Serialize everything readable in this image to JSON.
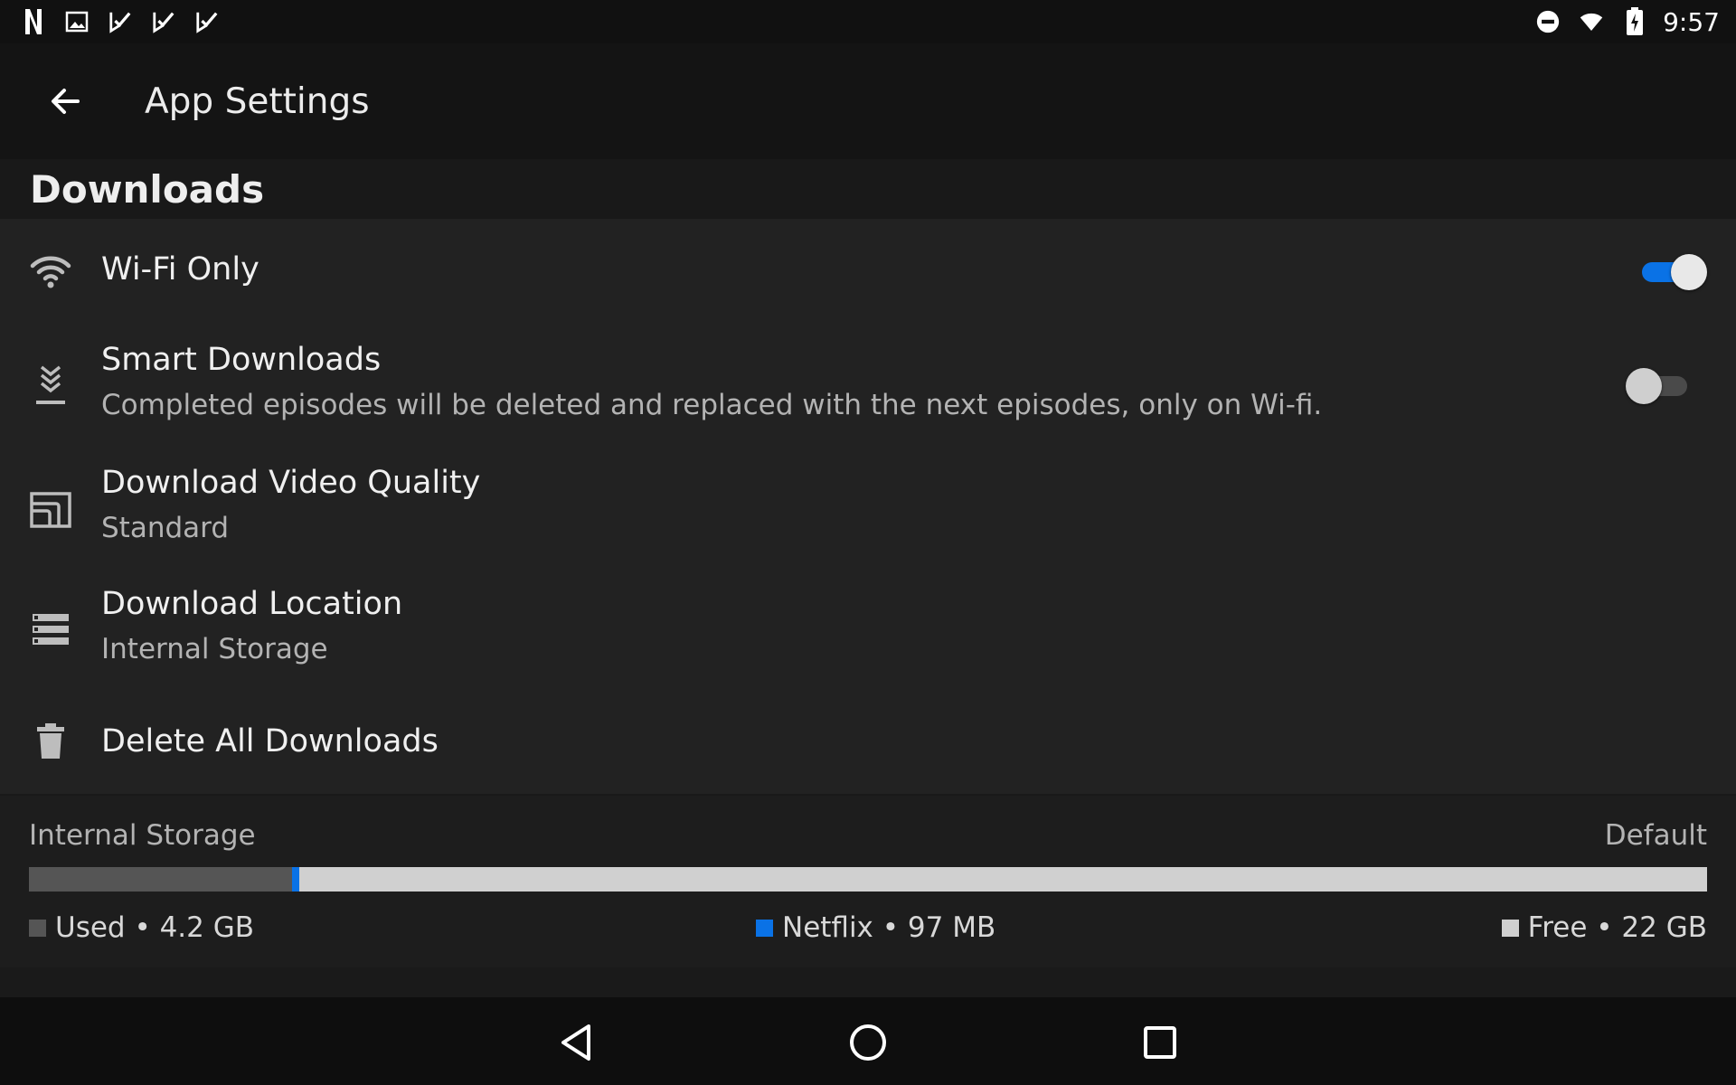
{
  "status_bar": {
    "time": "9:57",
    "left_icons": [
      "netflix-notification-icon",
      "image-notification-icon",
      "play-store-check-icon",
      "play-store-check-icon",
      "play-store-check-icon"
    ],
    "right_icons": [
      "do-not-disturb-icon",
      "wifi-icon",
      "battery-charging-icon"
    ]
  },
  "app_bar": {
    "title": "App Settings",
    "back_icon": "arrow-back-icon"
  },
  "section": {
    "title": "Downloads"
  },
  "settings": {
    "wifi_only": {
      "title": "Wi-Fi Only",
      "icon": "wifi-icon",
      "enabled": true
    },
    "smart_downloads": {
      "title": "Smart Downloads",
      "subtitle": "Completed episodes will be deleted and replaced with the next episodes, only on Wi-fi.",
      "icon": "smart-download-icon",
      "enabled": false
    },
    "video_quality": {
      "title": "Download Video Quality",
      "subtitle": "Standard",
      "icon": "video-quality-icon"
    },
    "location": {
      "title": "Download Location",
      "subtitle": "Internal Storage",
      "icon": "storage-icon"
    },
    "delete_all": {
      "title": "Delete All Downloads",
      "icon": "trash-icon"
    }
  },
  "storage": {
    "label": "Internal Storage",
    "default_label": "Default",
    "used_fraction": 0.157,
    "netflix_fraction": 0.004,
    "legend": {
      "used": "Used • 4.2 GB",
      "netflix": "Netflix • 97 MB",
      "free": "Free • 22 GB"
    },
    "colors": {
      "used": "#555555",
      "netflix": "#0a72e6",
      "free": "#d0d0d0"
    }
  },
  "nav_bar": {
    "buttons": [
      "nav-back-icon",
      "nav-home-icon",
      "nav-recents-icon"
    ]
  }
}
